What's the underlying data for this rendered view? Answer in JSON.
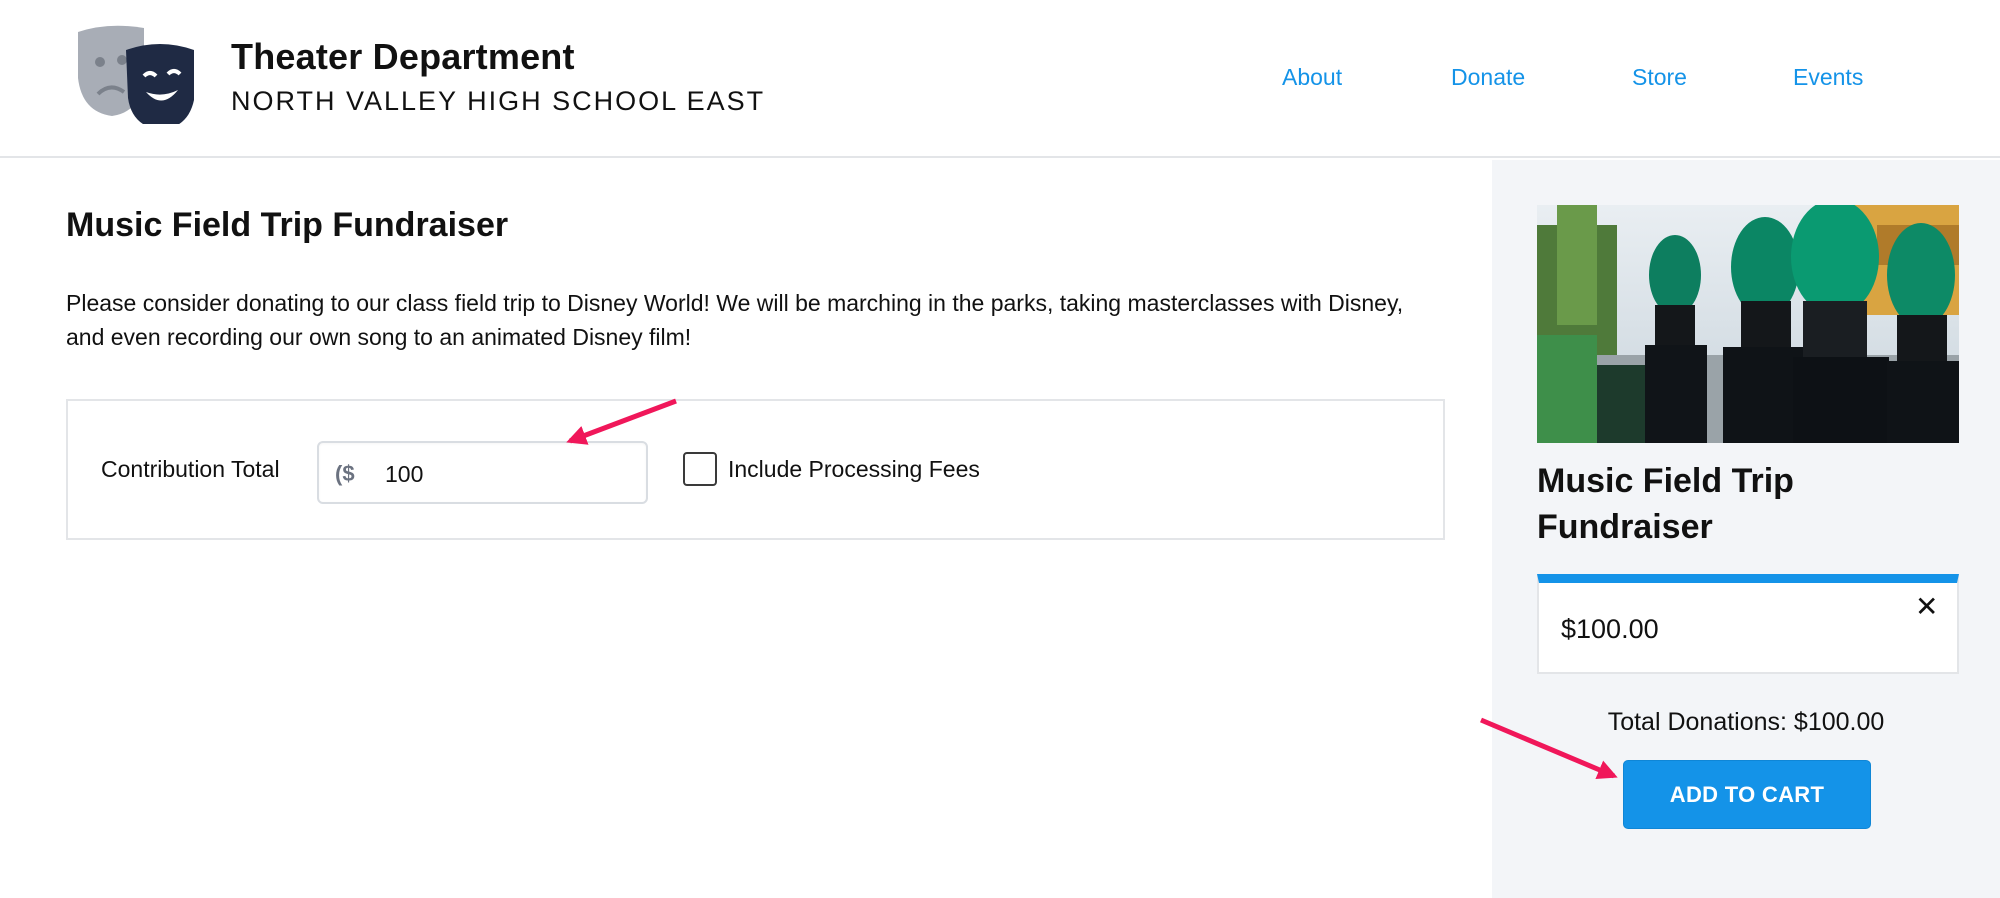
{
  "header": {
    "title": "Theater Department",
    "subtitle": "NORTH VALLEY HIGH SCHOOL EAST",
    "nav": [
      {
        "label": "About"
      },
      {
        "label": "Donate"
      },
      {
        "label": "Store"
      },
      {
        "label": "Events"
      }
    ]
  },
  "main": {
    "title": "Music Field Trip Fundraiser",
    "description": "Please consider donating to our class field trip to Disney World! We will be marching in the parks, taking masterclasses with Disney, and even recording our own song to an animated Disney film!",
    "form": {
      "contribution_label": "Contribution Total",
      "currency_prefix": "($",
      "amount_value": "100",
      "processing_fees_label": "Include Processing Fees",
      "processing_fees_checked": false
    }
  },
  "sidebar": {
    "title": "Music Field Trip Fundraiser",
    "cart_amount": "$100.00",
    "remove_icon": "close-icon",
    "total_line": "Total Donations: $100.00",
    "add_button": "ADD TO CART"
  },
  "colors": {
    "accent": "#1493e8",
    "annotation_arrow": "#f0175a",
    "logo_dark": "#1f2a44",
    "logo_light": "#a8adb6",
    "sidebar_bg": "#f3f5f8"
  }
}
